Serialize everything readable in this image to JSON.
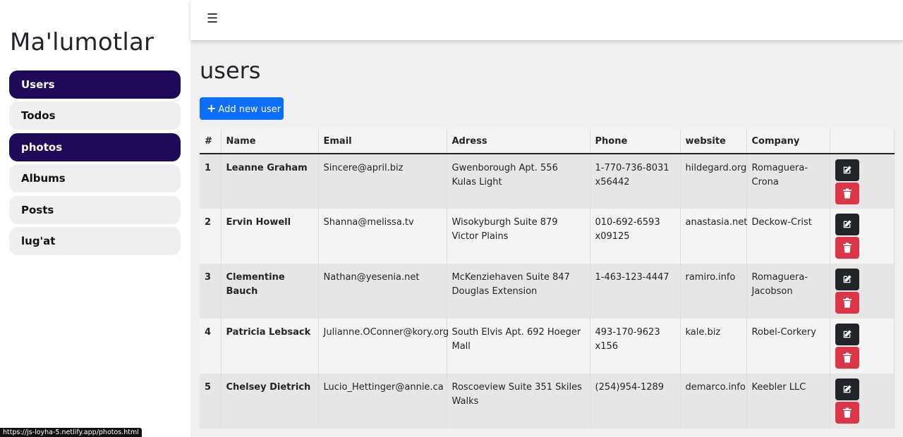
{
  "brand": "Ma'lumotlar",
  "sidebar": {
    "items": [
      {
        "label": "Users",
        "active": true
      },
      {
        "label": "Todos",
        "active": false
      },
      {
        "label": "photos",
        "active": true
      },
      {
        "label": "Albums",
        "active": false
      },
      {
        "label": "Posts",
        "active": false
      },
      {
        "label": "lug'at",
        "active": false
      }
    ]
  },
  "status_url": "https://js-loyha-5.netlify.app/photos.html",
  "topbar": {
    "menu_icon": "hamburger-icon"
  },
  "page": {
    "title": "users",
    "add_button": "Add new user"
  },
  "table": {
    "headers": [
      "#",
      "Name",
      "Email",
      "Adress",
      "Phone",
      "website",
      "Company",
      ""
    ],
    "rows": [
      {
        "id": "1",
        "name": "Leanne Graham",
        "email": "Sincere@april.biz",
        "address": "Gwenborough Apt. 556 Kulas Light",
        "phone": "1-770-736-8031 x56442",
        "website": "hildegard.org",
        "company": "Romaguera-Crona"
      },
      {
        "id": "2",
        "name": "Ervin Howell",
        "email": "Shanna@melissa.tv",
        "address": "Wisokyburgh Suite 879 Victor Plains",
        "phone": "010-692-6593 x09125",
        "website": "anastasia.net",
        "company": "Deckow-Crist"
      },
      {
        "id": "3",
        "name": "Clementine Bauch",
        "email": "Nathan@yesenia.net",
        "address": "McKenziehaven Suite 847 Douglas Extension",
        "phone": "1-463-123-4447",
        "website": "ramiro.info",
        "company": "Romaguera-Jacobson"
      },
      {
        "id": "4",
        "name": "Patricia Lebsack",
        "email": "Julianne.OConner@kory.org",
        "address": "South Elvis Apt. 692 Hoeger Mall",
        "phone": "493-170-9623 x156",
        "website": "kale.biz",
        "company": "Robel-Corkery"
      },
      {
        "id": "5",
        "name": "Chelsey Dietrich",
        "email": "Lucio_Hettinger@annie.ca",
        "address": "Roscoeview Suite 351 Skiles Walks",
        "phone": "(254)954-1289",
        "website": "demarco.info",
        "company": "Keebler LLC"
      }
    ]
  },
  "colors": {
    "nav_active": "#1f0a5a",
    "primary": "#0d6efd",
    "danger": "#dc3545",
    "dark": "#212529"
  }
}
